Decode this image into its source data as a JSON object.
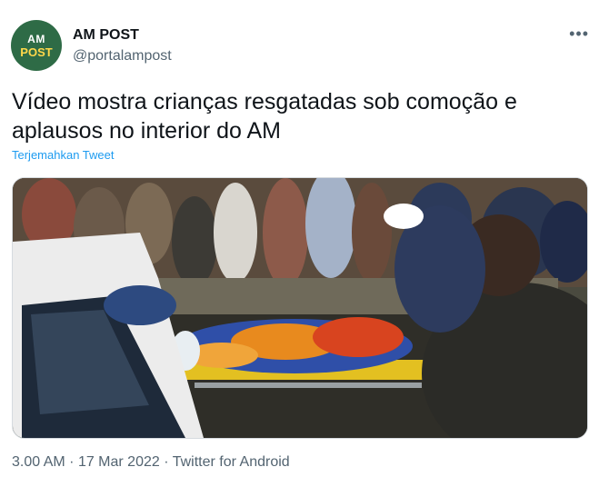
{
  "author": {
    "avatar_line1": "AM",
    "avatar_line2": "POST",
    "name": "AM POST",
    "handle": "@portalampost"
  },
  "more_icon": "•••",
  "tweet": {
    "text": "Vídeo mostra crianças resgatadas sob comoção e aplausos no interior do AM",
    "translate_label": "Terjemahkan Tweet"
  },
  "media": {
    "description_icon": "video-thumbnail"
  },
  "meta": {
    "time": "3.00 AM",
    "separator": "·",
    "date": "17 Mar 2022",
    "source": "Twitter for Android"
  },
  "colors": {
    "avatar_bg": "#2e6b46",
    "link": "#1d9bf0",
    "secondary_text": "#536471"
  }
}
